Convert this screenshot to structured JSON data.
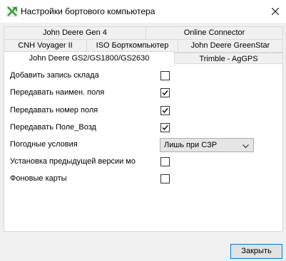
{
  "window": {
    "title": "Настройки бортового компьютера",
    "close_icon": "close-icon"
  },
  "tabs": {
    "row1": [
      "John Deere Gen 4",
      "Online Connector"
    ],
    "row2": [
      "CNH Voyager II",
      "ISO Борткомпьютер",
      "John Deere GreenStar"
    ],
    "row3": [
      "John Deere GS2/GS1800/GS2630",
      "Trimble - AgGPS"
    ],
    "active": "John Deere GS2/GS1800/GS2630"
  },
  "settings": [
    {
      "label": "Добавить запись склада",
      "checked": false
    },
    {
      "label": "Передавать наимен. поля",
      "checked": true
    },
    {
      "label": "Передавать номер поля",
      "checked": true
    },
    {
      "label": "Передавать Поле_Возд",
      "checked": true
    },
    {
      "label": "Погодные условия",
      "value": "Лишь при СЗР"
    },
    {
      "label": "Установка предыдущей версии мо",
      "checked": false
    },
    {
      "label": "Фоновые карты",
      "checked": false
    }
  ],
  "footer": {
    "close_label": "Закрыть"
  },
  "colors": {
    "accent": "#0078d7",
    "app_icon": "#3c9a3c"
  }
}
